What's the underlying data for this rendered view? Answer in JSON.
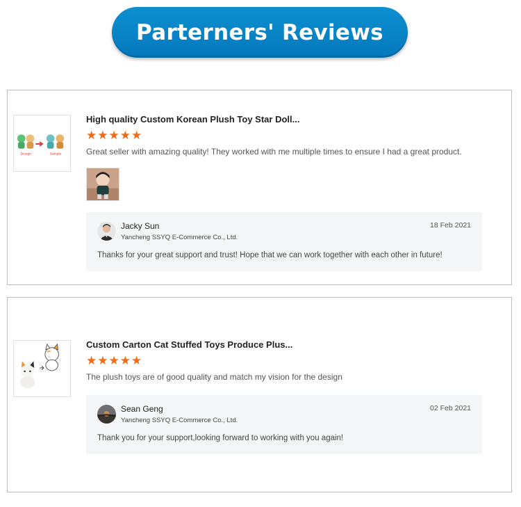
{
  "banner": {
    "title": "Parterners' Reviews"
  },
  "colors": {
    "banner_blue": "#0584c8",
    "star_orange": "#f26a13",
    "reply_bg": "#f5f6f8"
  },
  "reviews": [
    {
      "product_title": "High quality Custom Korean Plush Toy Star Doll...",
      "rating": 5,
      "stars": [
        "★",
        "★",
        "★",
        "★",
        "★"
      ],
      "review_text": "Great seller with amazing quality! They worked with me multiple times to ensure I had a great product.",
      "has_photo": true,
      "thumb_labels": {
        "left": "Design",
        "right": "Sample"
      },
      "reply": {
        "name": "Jacky Sun",
        "company": "Yancheng SSYQ E-Commerce Co., Ltd.",
        "date": "18 Feb 2021",
        "text": "Thanks for your great support and trust! Hope that we can work together with each other in future!"
      }
    },
    {
      "product_title": "Custom Carton Cat Stuffed Toys Produce Plus...",
      "rating": 5,
      "stars": [
        "★",
        "★",
        "★",
        "★",
        "★"
      ],
      "review_text": "The plush toys are of good quality and match my vision for the design",
      "has_photo": false,
      "reply": {
        "name": "Sean Geng",
        "company": "Yancheng SSYQ E-Commerce Co., Ltd.",
        "date": "02 Feb 2021",
        "text": "Thank you for your support,looking forward to working with you again!"
      }
    }
  ]
}
